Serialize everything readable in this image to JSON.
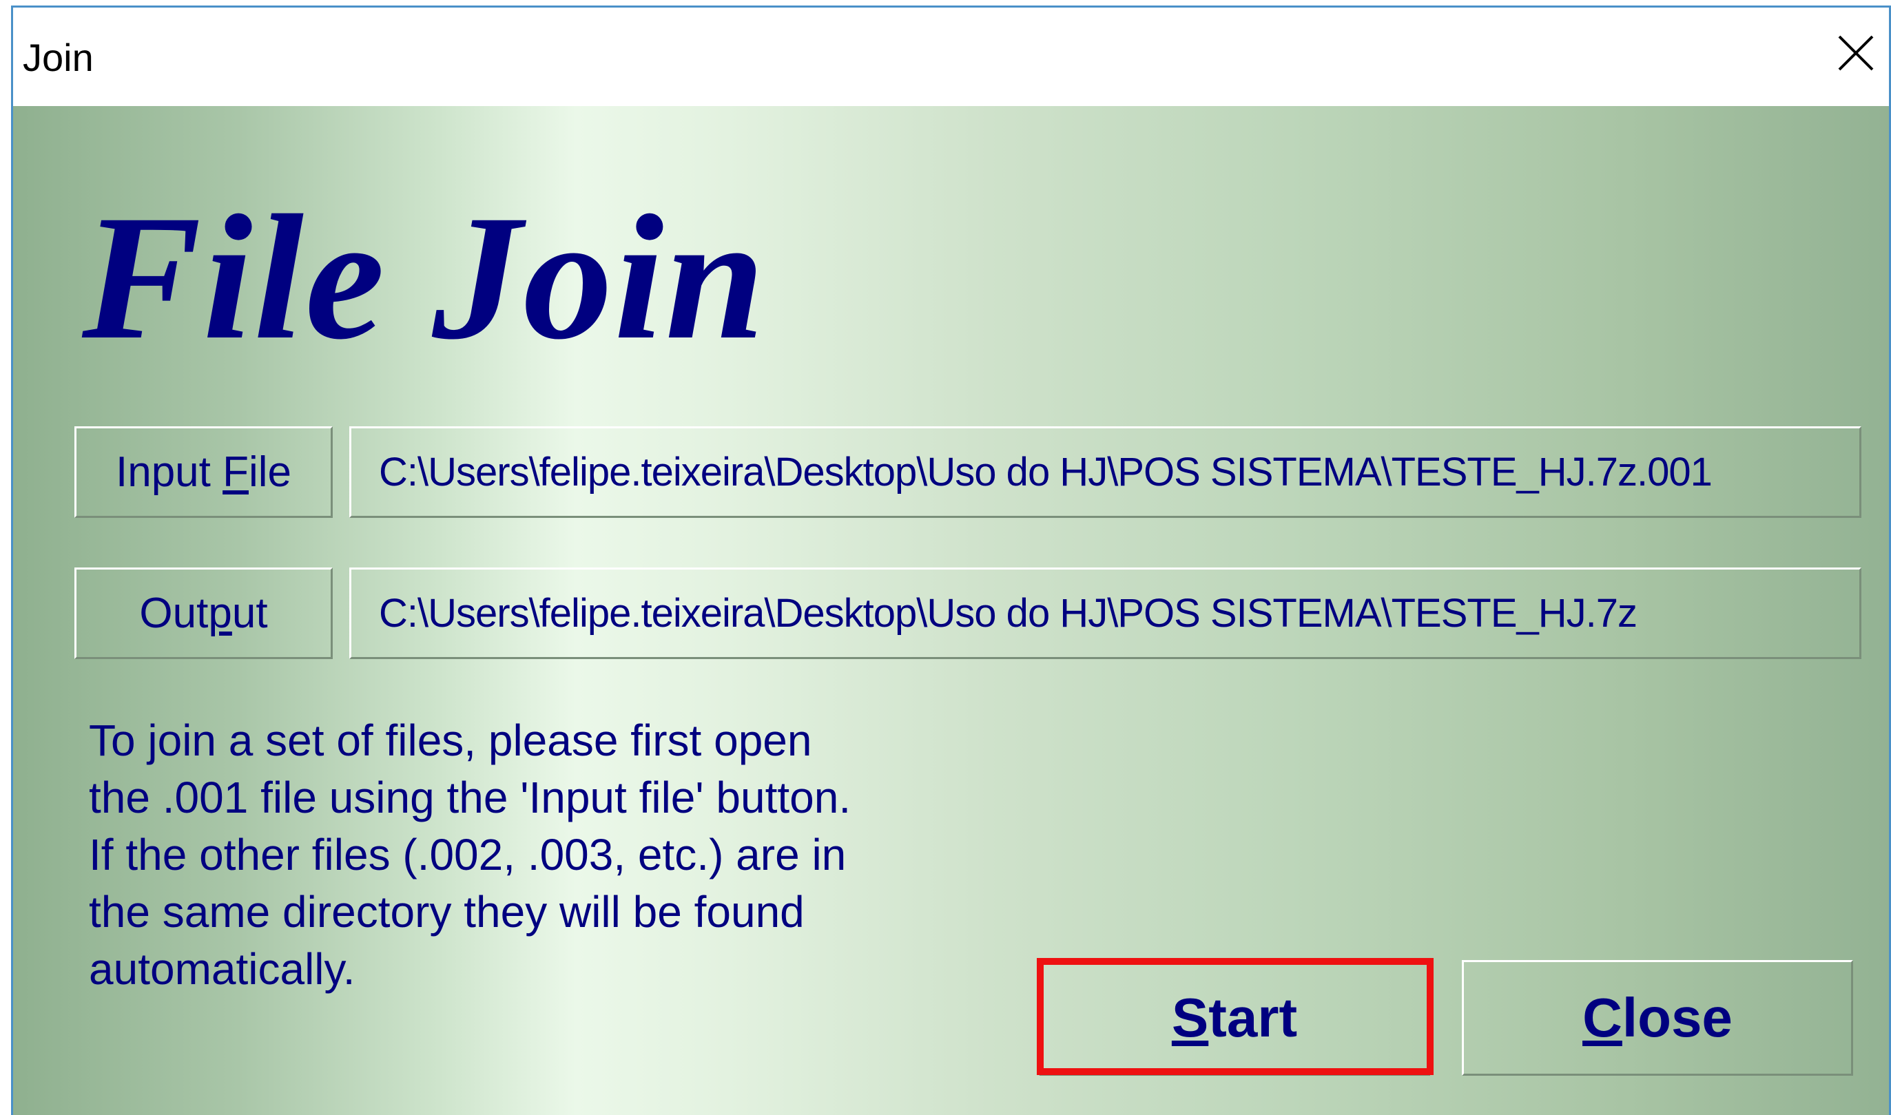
{
  "window": {
    "title": "Join",
    "close_glyph": "close-icon"
  },
  "app": {
    "heading": "File Join"
  },
  "input_file": {
    "button_pre": "Input ",
    "button_accel": "F",
    "button_post": "ile",
    "value": "C:\\Users\\felipe.teixeira\\Desktop\\Uso do HJ\\POS SISTEMA\\TESTE_HJ.7z.001"
  },
  "output": {
    "button_pre": "Out",
    "button_accel": "p",
    "button_post": "ut",
    "value": "C:\\Users\\felipe.teixeira\\Desktop\\Uso do HJ\\POS SISTEMA\\TESTE_HJ.7z"
  },
  "description": {
    "lines": [
      "To join a set of files, please first open",
      "the .001 file using the 'Input file' button.",
      "If the other files (.002, .003, etc.) are in",
      "the same directory they will be found",
      "automatically."
    ]
  },
  "actions": {
    "start_accel": "S",
    "start_rest": "tart",
    "close_accel": "C",
    "close_rest": "lose"
  },
  "colors": {
    "text": "#000080",
    "highlight": "#ee1111",
    "window_border": "#4a90c8"
  }
}
